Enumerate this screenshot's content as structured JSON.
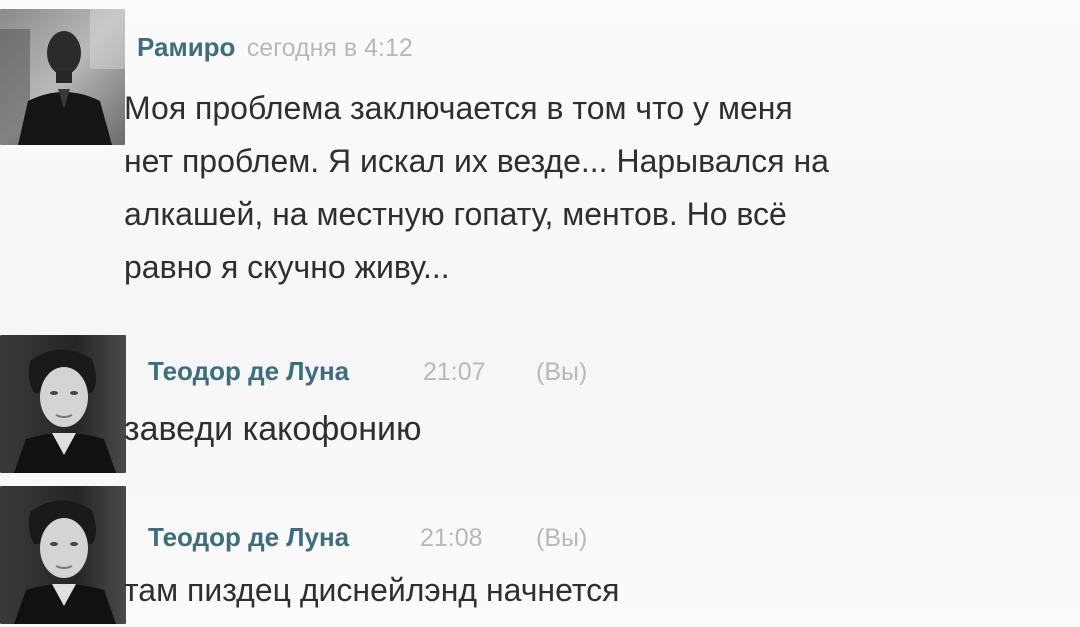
{
  "messages": [
    {
      "author": "Рамиро",
      "time": "сегодня в 4:12",
      "lines": [
        "Моя проблема заключается в том что у меня",
        "нет проблем. Я искал их везде... Нарывался на",
        "алкашей, на местную гопату, ментов. Но всё",
        "равно я скучно живу..."
      ]
    },
    {
      "author": "Теодор де Луна",
      "time": "21:07",
      "you": "(Вы)",
      "text": "заведи какофонию"
    },
    {
      "author": "Теодор де Луна",
      "time": "21:08",
      "you": "(Вы)",
      "text": "там пиздец диснейлэнд начнется"
    }
  ],
  "colors": {
    "author": "#3d6e80",
    "meta": "#b8b8b8",
    "text": "#2f2f2f"
  },
  "icons": {
    "avatar_1": "avatar-photo",
    "avatar_2": "avatar-photo",
    "avatar_3": "avatar-photo"
  }
}
